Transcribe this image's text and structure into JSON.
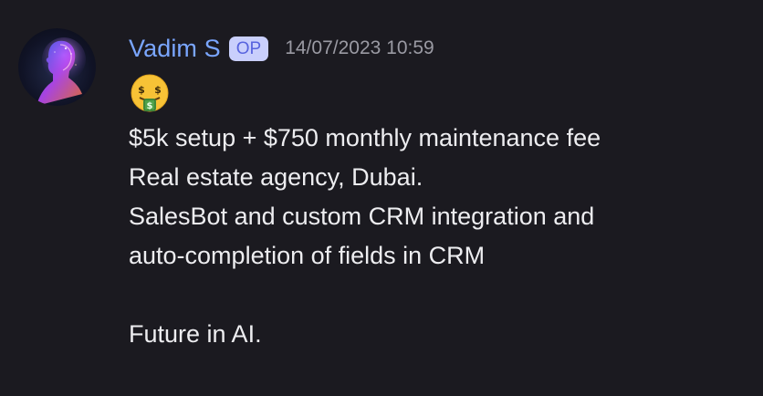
{
  "message": {
    "author": "Vadim S",
    "badge": "OP",
    "timestamp": "14/07/2023 10:59",
    "emoji_icon": "money-mouth-face-icon",
    "lines": [
      "$5k setup + $750 monthly maintenance fee",
      "Real estate agency, Dubai.",
      "SalesBot and custom CRM integration and",
      "auto-completion of fields in CRM",
      "",
      "Future in AI."
    ]
  },
  "colors": {
    "background": "#1b1a20",
    "author": "#7aa6ff",
    "badge_bg": "#c9cffc",
    "badge_text": "#5763de",
    "timestamp": "#9a9aa3",
    "text": "#ededf0"
  }
}
